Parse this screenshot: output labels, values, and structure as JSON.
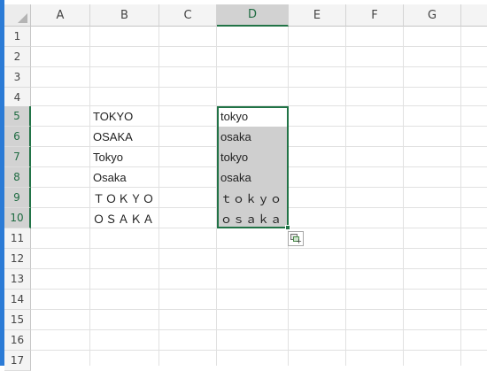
{
  "columns": [
    "A",
    "B",
    "C",
    "D",
    "E",
    "F",
    "G"
  ],
  "selected_column": "D",
  "rows": [
    "1",
    "2",
    "3",
    "4",
    "5",
    "6",
    "7",
    "8",
    "9",
    "10",
    "11",
    "12",
    "13",
    "14",
    "15",
    "16",
    "17"
  ],
  "selected_rows": [
    "5",
    "6",
    "7",
    "8",
    "9",
    "10"
  ],
  "column_b": [
    "TOKYO",
    "OSAKA",
    "Tokyo",
    "Osaka",
    "ＴＯＫＹＯ",
    "ＯＳＡＫＡ"
  ],
  "column_d": [
    "tokyo",
    "osaka",
    "tokyo",
    "osaka",
    "ｔｏｋｙｏ",
    "ｏｓａｋａ"
  ],
  "colors": {
    "selection_border": "#217346",
    "selection_fill": "#cfcfcf",
    "left_strip": "#2b7bd6"
  },
  "icons": {
    "corner": "select-all-triangle-icon",
    "quick_analysis": "quick-analysis-icon"
  }
}
